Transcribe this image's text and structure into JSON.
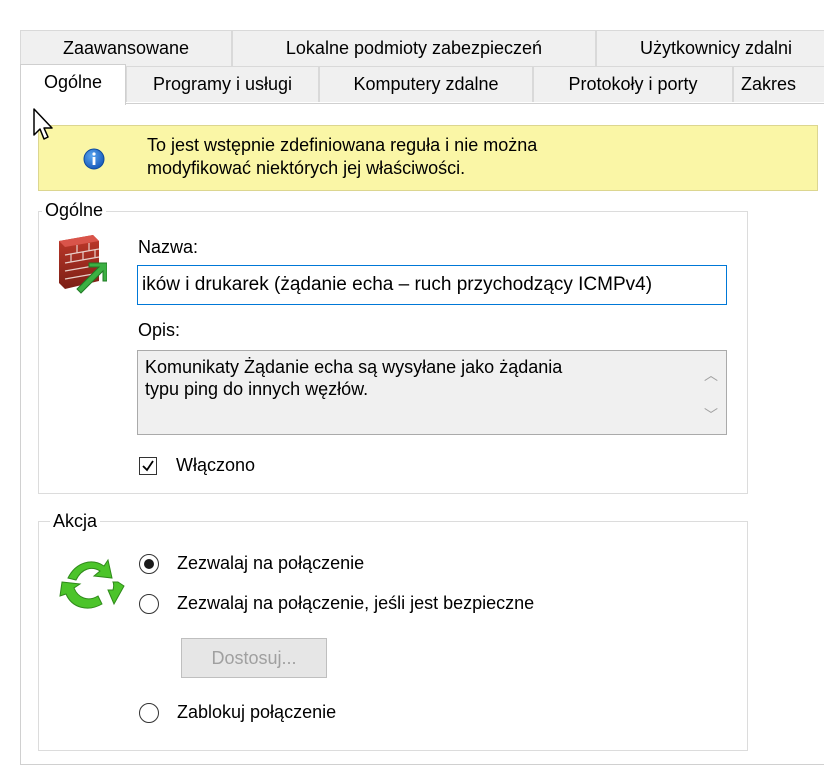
{
  "tabs_row1": [
    {
      "label": "Zaawansowane"
    },
    {
      "label": "Lokalne podmioty zabezpieczeń"
    },
    {
      "label": "Użytkownicy zdalni"
    }
  ],
  "tabs_row2": [
    {
      "label": "Ogólne",
      "active": true
    },
    {
      "label": "Programy i usługi"
    },
    {
      "label": "Komputery zdalne"
    },
    {
      "label": "Protokoły i porty"
    },
    {
      "label": "Zakres"
    }
  ],
  "info_banner": {
    "icon": "info-icon",
    "line1": "To jest wstępnie zdefiniowana reguła i nie można",
    "line2": "modyfikować niektórych jej właściwości."
  },
  "general": {
    "title": "Ogólne",
    "icon": "firewall-icon",
    "name_label": "Nazwa:",
    "name_value": "ików i drukarek (żądanie echa – ruch przychodzący ICMPv4)",
    "desc_label": "Opis:",
    "desc_line1": "Komunikaty Żądanie echa są wysyłane jako żądania",
    "desc_line2": "typu ping do innych węzłów.",
    "enabled_label": "Włączono",
    "enabled": true
  },
  "action": {
    "title": "Akcja",
    "icon": "recycle-arrows-icon",
    "options": [
      {
        "label": "Zezwalaj na połączenie",
        "selected": true
      },
      {
        "label": "Zezwalaj na połączenie, jeśli jest bezpieczne",
        "selected": false
      },
      {
        "label": "Zablokuj połączenie",
        "selected": false
      }
    ],
    "customize_label": "Dostosuj..."
  },
  "colors": {
    "info_bg": "#faf6a6",
    "focus_border": "#0078d7",
    "icon_blue": "#1e6fd0",
    "arrow_green": "#3cb043"
  }
}
